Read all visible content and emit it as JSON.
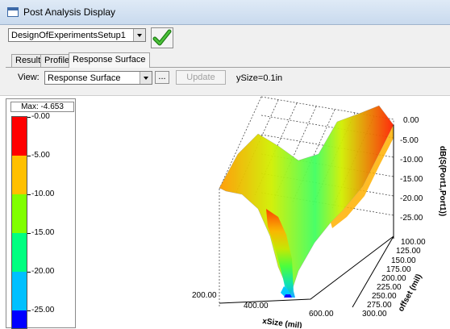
{
  "window": {
    "title": "Post Analysis Display"
  },
  "setup_select": {
    "value": "DesignOfExperimentsSetup1"
  },
  "tabs": [
    {
      "label": "Result",
      "active": false
    },
    {
      "label": "Profile",
      "active": false
    },
    {
      "label": "Response Surface",
      "active": true
    }
  ],
  "view_bar": {
    "view_label": "View:",
    "view_value": "Response Surface",
    "ellipsis_label": "...",
    "update_label": "Update",
    "fixed_param": "ySize=0.1in"
  },
  "legend": {
    "max_text": "Max: -4.653",
    "ticks": [
      "-0.00",
      "-5.00",
      "-10.00",
      "-15.00",
      "-20.00",
      "-25.00"
    ],
    "colors": [
      "#ff0000",
      "#ffc000",
      "#80ff00",
      "#00ff80",
      "#00c0ff",
      "#0000ff"
    ]
  },
  "plot": {
    "z_axis_label": "dB(S(Port1,Port1))",
    "z_ticks": [
      "0.00",
      "-5.00",
      "-10.00",
      "-15.00",
      "-20.00",
      "-25.00"
    ],
    "offset_axis_label": "offset (mil)",
    "offset_ticks": [
      "100.00",
      "125.00",
      "150.00",
      "175.00",
      "200.00",
      "225.00",
      "250.00",
      "275.00",
      "300.00"
    ],
    "xsize_axis_label": "xSize (mil)",
    "xsize_ticks": [
      "200.00",
      "400.00",
      "600.00"
    ]
  },
  "colors": {
    "ok_check": "#2e9b20",
    "titlebar": "#cfe0f2"
  }
}
